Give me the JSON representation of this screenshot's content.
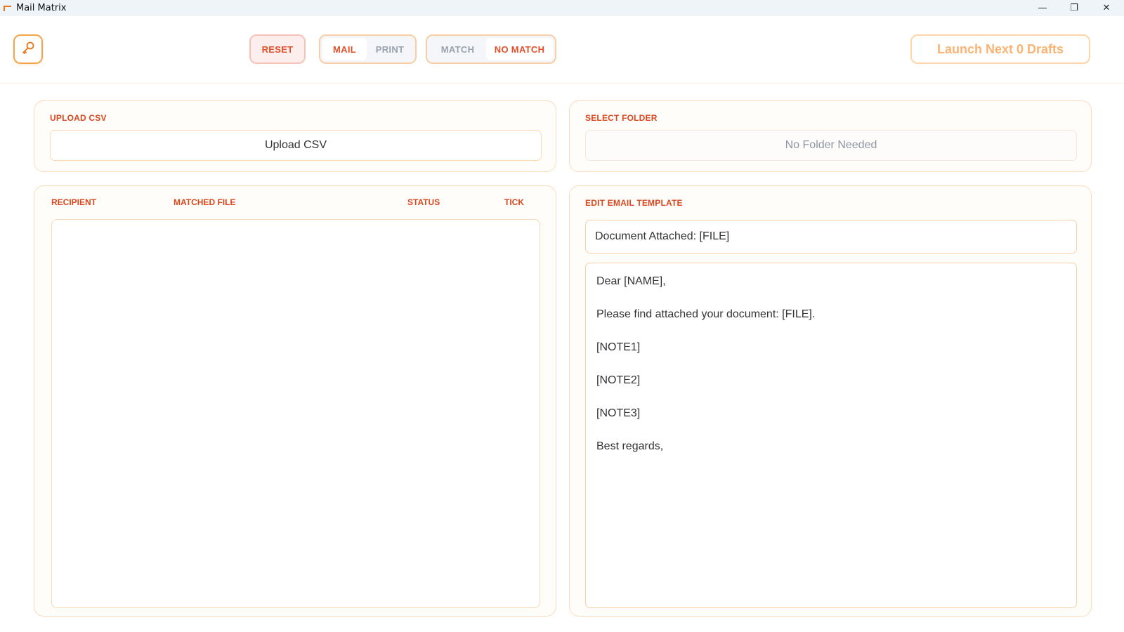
{
  "window": {
    "title": "Mail Matrix",
    "minimize": "—",
    "maximize": "❐",
    "close": "✕"
  },
  "toolbar": {
    "key_icon": "key-icon",
    "reset_label": "RESET",
    "mode": {
      "options": [
        "MAIL",
        "PRINT"
      ],
      "selected": "MAIL"
    },
    "match": {
      "options": [
        "MATCH",
        "NO MATCH"
      ],
      "selected": "NO MATCH"
    },
    "launch_label": "Launch Next 0 Drafts"
  },
  "upload": {
    "label": "UPLOAD CSV",
    "button_label": "Upload CSV"
  },
  "folder": {
    "label": "SELECT FOLDER",
    "button_label": "No Folder Needed"
  },
  "table": {
    "columns": [
      "RECIPIENT",
      "MATCHED FILE",
      "STATUS",
      "TICK"
    ],
    "rows": []
  },
  "template": {
    "label": "EDIT EMAIL TEMPLATE",
    "subject": "Document Attached: [FILE]",
    "body_lines": [
      "Dear [NAME],",
      "Please find attached your document: [FILE].",
      "[NOTE1]",
      "[NOTE2]",
      "[NOTE3]",
      "Best regards,"
    ]
  },
  "colors": {
    "accent": "#e1502a",
    "border": "#fbdcbc",
    "key_border": "#f4a44a",
    "launch_text": "#f9b373"
  }
}
